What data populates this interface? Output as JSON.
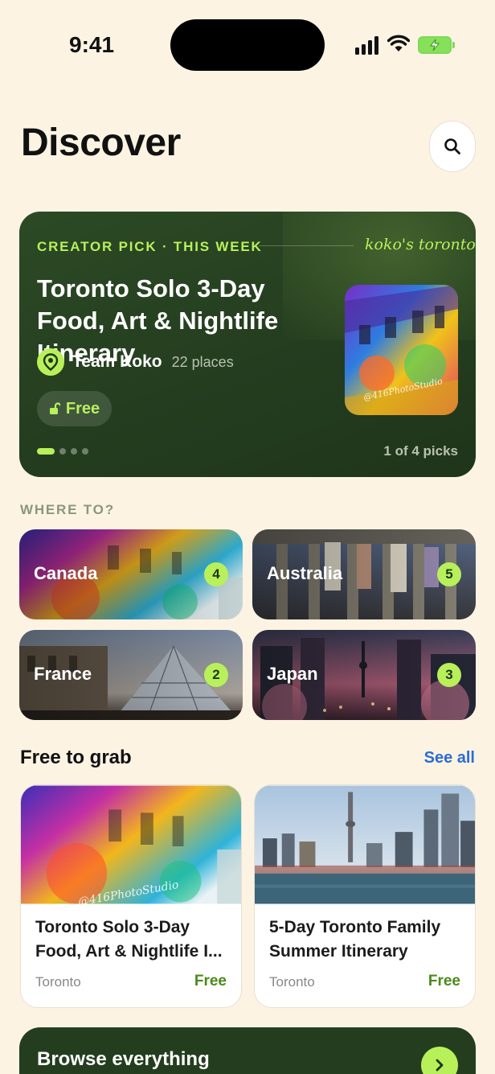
{
  "status_bar": {
    "time": "9:41"
  },
  "header": {
    "title": "Discover"
  },
  "hero": {
    "eyebrow": "CREATOR PICK · THIS WEEK",
    "brand": "koko's toronto",
    "title": "Toronto Solo 3-Day Food, Art & Nightlife Itinerary",
    "author": "Team Koko",
    "places": "22 places",
    "price": "Free",
    "counter": "1 of 4 picks",
    "page_index": 1,
    "page_total": 4
  },
  "where_to": {
    "caption": "WHERE TO?",
    "destinations": [
      {
        "name": "Canada",
        "count": "4"
      },
      {
        "name": "Australia",
        "count": "5"
      },
      {
        "name": "France",
        "count": "2"
      },
      {
        "name": "Japan",
        "count": "3"
      }
    ]
  },
  "free_to_grab": {
    "title": "Free to grab",
    "see_all": "See all",
    "cards": [
      {
        "title": "Toronto Solo 3-Day Food, Art & Nightlife I...",
        "city": "Toronto",
        "price": "Free"
      },
      {
        "title": "5-Day Toronto Family Summer Itinerary",
        "city": "Toronto",
        "price": "Free"
      }
    ]
  },
  "browse": {
    "title": "Browse everything"
  },
  "colors": {
    "accent": "#b8f05a",
    "dark_green": "#243d1f",
    "background": "#fdf3e3",
    "link": "#2c6bd6"
  }
}
